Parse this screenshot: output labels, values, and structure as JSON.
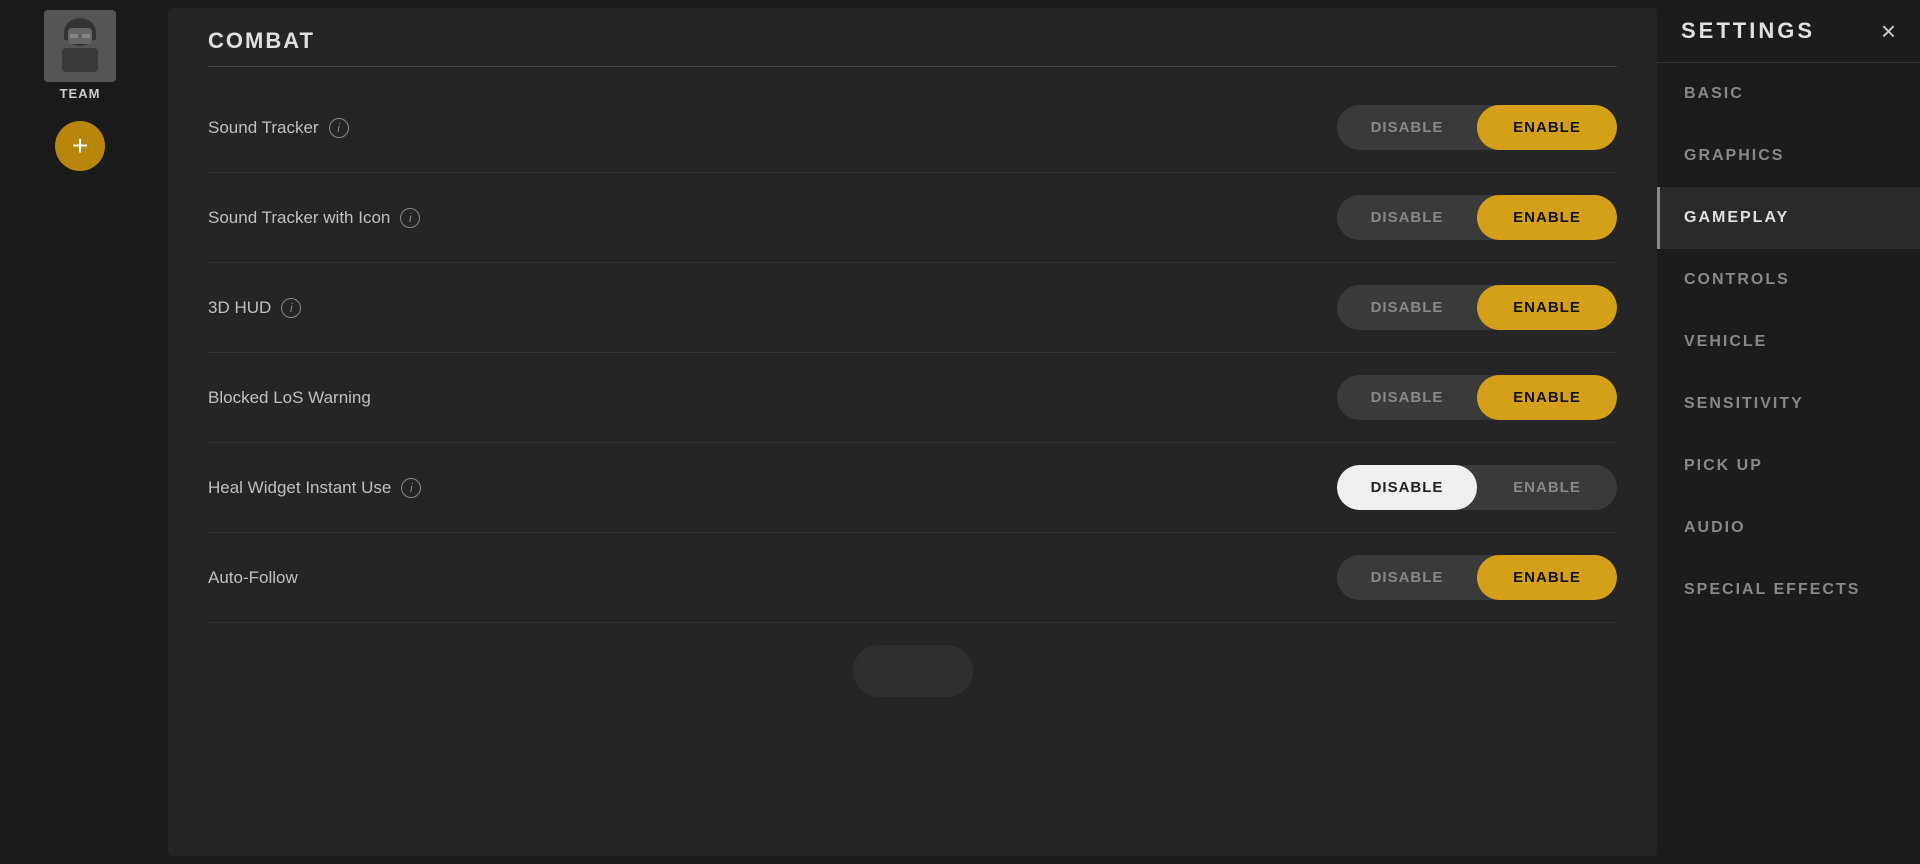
{
  "left_sidebar": {
    "team_label": "TEAM",
    "add_button_label": "+"
  },
  "header": {
    "settings_title": "SETTINGS",
    "close_icon": "×"
  },
  "section": {
    "title": "COMBAT"
  },
  "settings": [
    {
      "id": "sound_tracker",
      "label": "Sound Tracker",
      "has_info": true,
      "disable_label": "DISABLE",
      "enable_label": "ENABLE",
      "active": "enable"
    },
    {
      "id": "sound_tracker_icon",
      "label": "Sound Tracker with Icon",
      "has_info": true,
      "disable_label": "DISABLE",
      "enable_label": "ENABLE",
      "active": "enable"
    },
    {
      "id": "3d_hud",
      "label": "3D HUD",
      "has_info": true,
      "disable_label": "DISABLE",
      "enable_label": "ENABLE",
      "active": "enable"
    },
    {
      "id": "blocked_los",
      "label": "Blocked LoS Warning",
      "has_info": false,
      "disable_label": "DISABLE",
      "enable_label": "ENABLE",
      "active": "enable"
    },
    {
      "id": "heal_widget",
      "label": "Heal Widget Instant Use",
      "has_info": true,
      "disable_label": "DISABLE",
      "enable_label": "ENABLE",
      "active": "disable"
    },
    {
      "id": "auto_follow",
      "label": "Auto-Follow",
      "has_info": false,
      "disable_label": "DISABLE",
      "enable_label": "ENABLE",
      "active": "enable"
    }
  ],
  "nav": {
    "items": [
      {
        "id": "basic",
        "label": "BASIC",
        "active": false
      },
      {
        "id": "graphics",
        "label": "GRAPHICS",
        "active": false
      },
      {
        "id": "gameplay",
        "label": "GAMEPLAY",
        "active": true
      },
      {
        "id": "controls",
        "label": "CONTROLS",
        "active": false
      },
      {
        "id": "vehicle",
        "label": "VEHICLE",
        "active": false
      },
      {
        "id": "sensitivity",
        "label": "SENSITIVITY",
        "active": false
      },
      {
        "id": "pick_up",
        "label": "PICK UP",
        "active": false
      },
      {
        "id": "audio",
        "label": "AUDIO",
        "active": false
      },
      {
        "id": "special_effects",
        "label": "SPECIAL EFFECTS",
        "active": false
      }
    ]
  }
}
